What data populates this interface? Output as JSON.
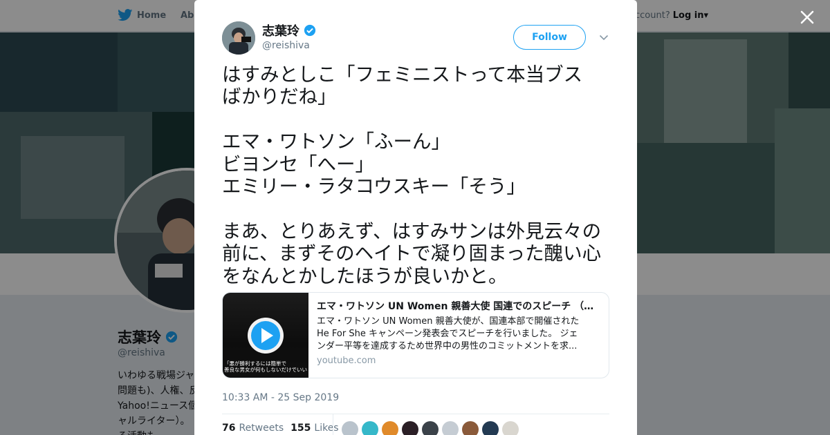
{
  "nav": {
    "home_label": "Home",
    "about_label": "Abo",
    "account_prompt": "ccount?",
    "login_label": "Log in"
  },
  "background_profile": {
    "name": "志葉玲",
    "handle": "@reishiva",
    "bio_lines": [
      "いわゆる戦場ジャ",
      "問題も)、人権、反",
      "Yahoo!ニュース個",
      "ャルライター）。",
      "る活動も。"
    ]
  },
  "tweet": {
    "author_name": "志葉玲",
    "author_handle": "@reishiva",
    "follow_label": "Follow",
    "text_lines": [
      "はすみとしこ「フェミニストって本当ブス",
      "ばかりだね」",
      "",
      "エマ・ワトソン「ふーん」",
      "ビヨンセ「へー」",
      "エミリー・ラタコウスキー「そう」",
      "",
      "まあ、とりあえず、はすみサンは外見云々の",
      "前に、まずそのヘイトで凝り固まった醜い心",
      "をなんとかしたほうが良いかと。"
    ],
    "card": {
      "title": "エマ・ワトソン UN Women 親善大使 国連でのスピーチ （日...",
      "description_lines": [
        "エマ・ワトソン UN Women 親善大使が、国連本部で開催された",
        "He For She キャンペーン発表会でスピーチを行いました。 ジェ",
        "ンダー平等を達成するため世界中の男性のコミットメントを求..."
      ],
      "domain": "youtube.com",
      "thumb_caption_lines": [
        "「悪が勝利するには簡単で",
        "善良な男女が何もしないだけでいい」"
      ]
    },
    "timestamp": "10:33 AM - 25 Sep 2019",
    "retweets_count": "76",
    "retweets_label": "Retweets",
    "likes_count": "155",
    "likes_label": "Likes",
    "liker_colors": [
      "#b9c3cc",
      "#36b8c9",
      "#e08a2a",
      "#2b1f26",
      "#3b4249",
      "#c5ccd3",
      "#8a5a3a",
      "#233a52",
      "#d9d6cf"
    ]
  },
  "colors": {
    "accent": "#1da1f2",
    "text": "#14171a",
    "muted": "#657786",
    "verified": "#1da1f2"
  },
  "icons": [
    "twitter-bird-icon",
    "verified-badge-icon",
    "close-icon",
    "chevron-down-icon",
    "play-icon",
    "caret-down-icon"
  ]
}
